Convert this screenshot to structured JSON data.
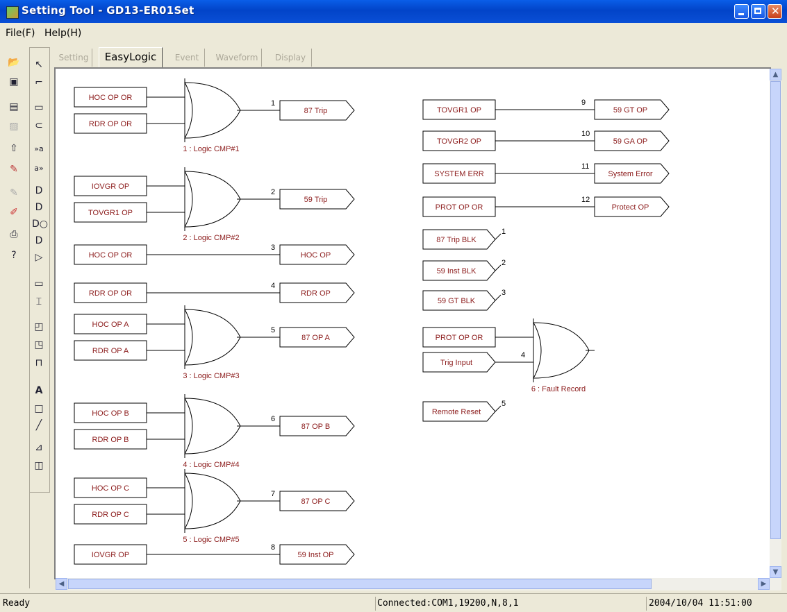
{
  "window": {
    "title": "Setting Tool - GD13-ER01Set"
  },
  "menu": {
    "file": "File(F)",
    "help": "Help(H)"
  },
  "tabs": [
    "Setting",
    "EasyLogic",
    "Event",
    "Waveform",
    "Display"
  ],
  "active_tab": "EasyLogic",
  "toolbar_icons": [
    "open-folder-icon",
    "save-icon",
    "list-icon",
    "chart-icon",
    "upload-icon",
    "write-icon",
    "read-icon",
    "compare-icon",
    "print-icon",
    "help-icon"
  ],
  "palette_icons": [
    "pointer-icon",
    "connector-icon",
    "input-tag-icon",
    "input-tag-rounded-icon",
    "text-in-icon",
    "text-out-icon",
    "and-gate-icon",
    "and-gate-icon-2",
    "nand-gate-icon",
    "or-gate-icon",
    "not-gate-icon",
    "tag-icon",
    "bracket-icon",
    "timer-on-icon",
    "timer-off-icon",
    "pulse-icon",
    "text-tool-icon",
    "rectangle-tool-icon",
    "line-tool-icon",
    "flip-icon",
    "properties-icon"
  ],
  "gates": [
    {
      "inputs": [
        "HOC OP OR",
        "RDR OP OR"
      ],
      "num": "1",
      "output": "87 Trip",
      "caption": "1 : Logic CMP#1"
    },
    {
      "inputs": [
        "IOVGR OP",
        "TOVGR1 OP"
      ],
      "num": "2",
      "output": "59 Trip",
      "caption": "2 : Logic CMP#2"
    },
    {
      "inputs": [
        "HOC OP A",
        "RDR OP A"
      ],
      "num": "5",
      "output": "87 OP A",
      "caption": "3 : Logic CMP#3"
    },
    {
      "inputs": [
        "HOC OP B",
        "RDR OP B"
      ],
      "num": "6",
      "output": "87 OP B",
      "caption": "4 : Logic CMP#4"
    },
    {
      "inputs": [
        "HOC OP C",
        "RDR OP C"
      ],
      "num": "7",
      "output": "87 OP C",
      "caption": "5 : Logic CMP#5"
    }
  ],
  "direct_links": [
    {
      "input": "HOC OP OR",
      "num": "3",
      "output": "HOC OP"
    },
    {
      "input": "RDR OP OR",
      "num": "4",
      "output": "RDR OP"
    },
    {
      "input": "IOVGR OP",
      "num": "8",
      "output": "59 Inst OP"
    },
    {
      "input": "TOVGR1 OP",
      "num": "9",
      "output": "59 GT OP"
    },
    {
      "input": "TOVGR2 OP",
      "num": "10",
      "output": "59 GA OP"
    },
    {
      "input": "SYSTEM ERR",
      "num": "11",
      "output": "System Error"
    },
    {
      "input": "PROT OP OR",
      "num": "12",
      "output": "Protect OP"
    }
  ],
  "remote_inputs": [
    {
      "label": "87 Trip BLK",
      "num": "1"
    },
    {
      "label": "59 Inst BLK",
      "num": "2"
    },
    {
      "label": "59 GT BLK",
      "num": "3"
    }
  ],
  "fault_record": {
    "inputs": [
      "PROT OP OR",
      "Trig Input"
    ],
    "input_num": "4",
    "caption": "6 : Fault Record"
  },
  "remote_reset": {
    "label": "Remote Reset",
    "num": "5"
  },
  "status": {
    "ready": "Ready",
    "connection": "Connected:COM1,19200,N,8,1",
    "datetime": "2004/10/04 11:51:00"
  }
}
